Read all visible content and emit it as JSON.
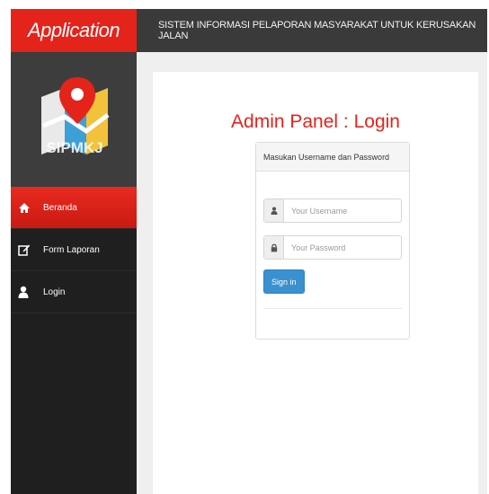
{
  "brand": {
    "title": "Application"
  },
  "header": {
    "title": "SISTEM INFORMASI PELAPORAN MASYARAKAT UNTUK KERUSAKAN JALAN"
  },
  "sidebar": {
    "logo_text": "SIPMKJ",
    "items": [
      {
        "label": "Beranda",
        "icon": "home-icon",
        "active": true
      },
      {
        "label": "Form Laporan",
        "icon": "edit-icon",
        "active": false
      },
      {
        "label": "Login",
        "icon": "user-icon",
        "active": false
      }
    ]
  },
  "main": {
    "title": "Admin Panel : Login",
    "panel_heading": "Masukan Username dan Password",
    "username": {
      "placeholder": "Your Username",
      "value": ""
    },
    "password": {
      "placeholder": "Your Password",
      "value": ""
    },
    "signin_label": "Sign in"
  },
  "colors": {
    "brand_red": "#e4231b",
    "topbar": "#3a3a3a",
    "sidebar": "#1f1f1f",
    "primary_blue": "#3a91cf"
  }
}
